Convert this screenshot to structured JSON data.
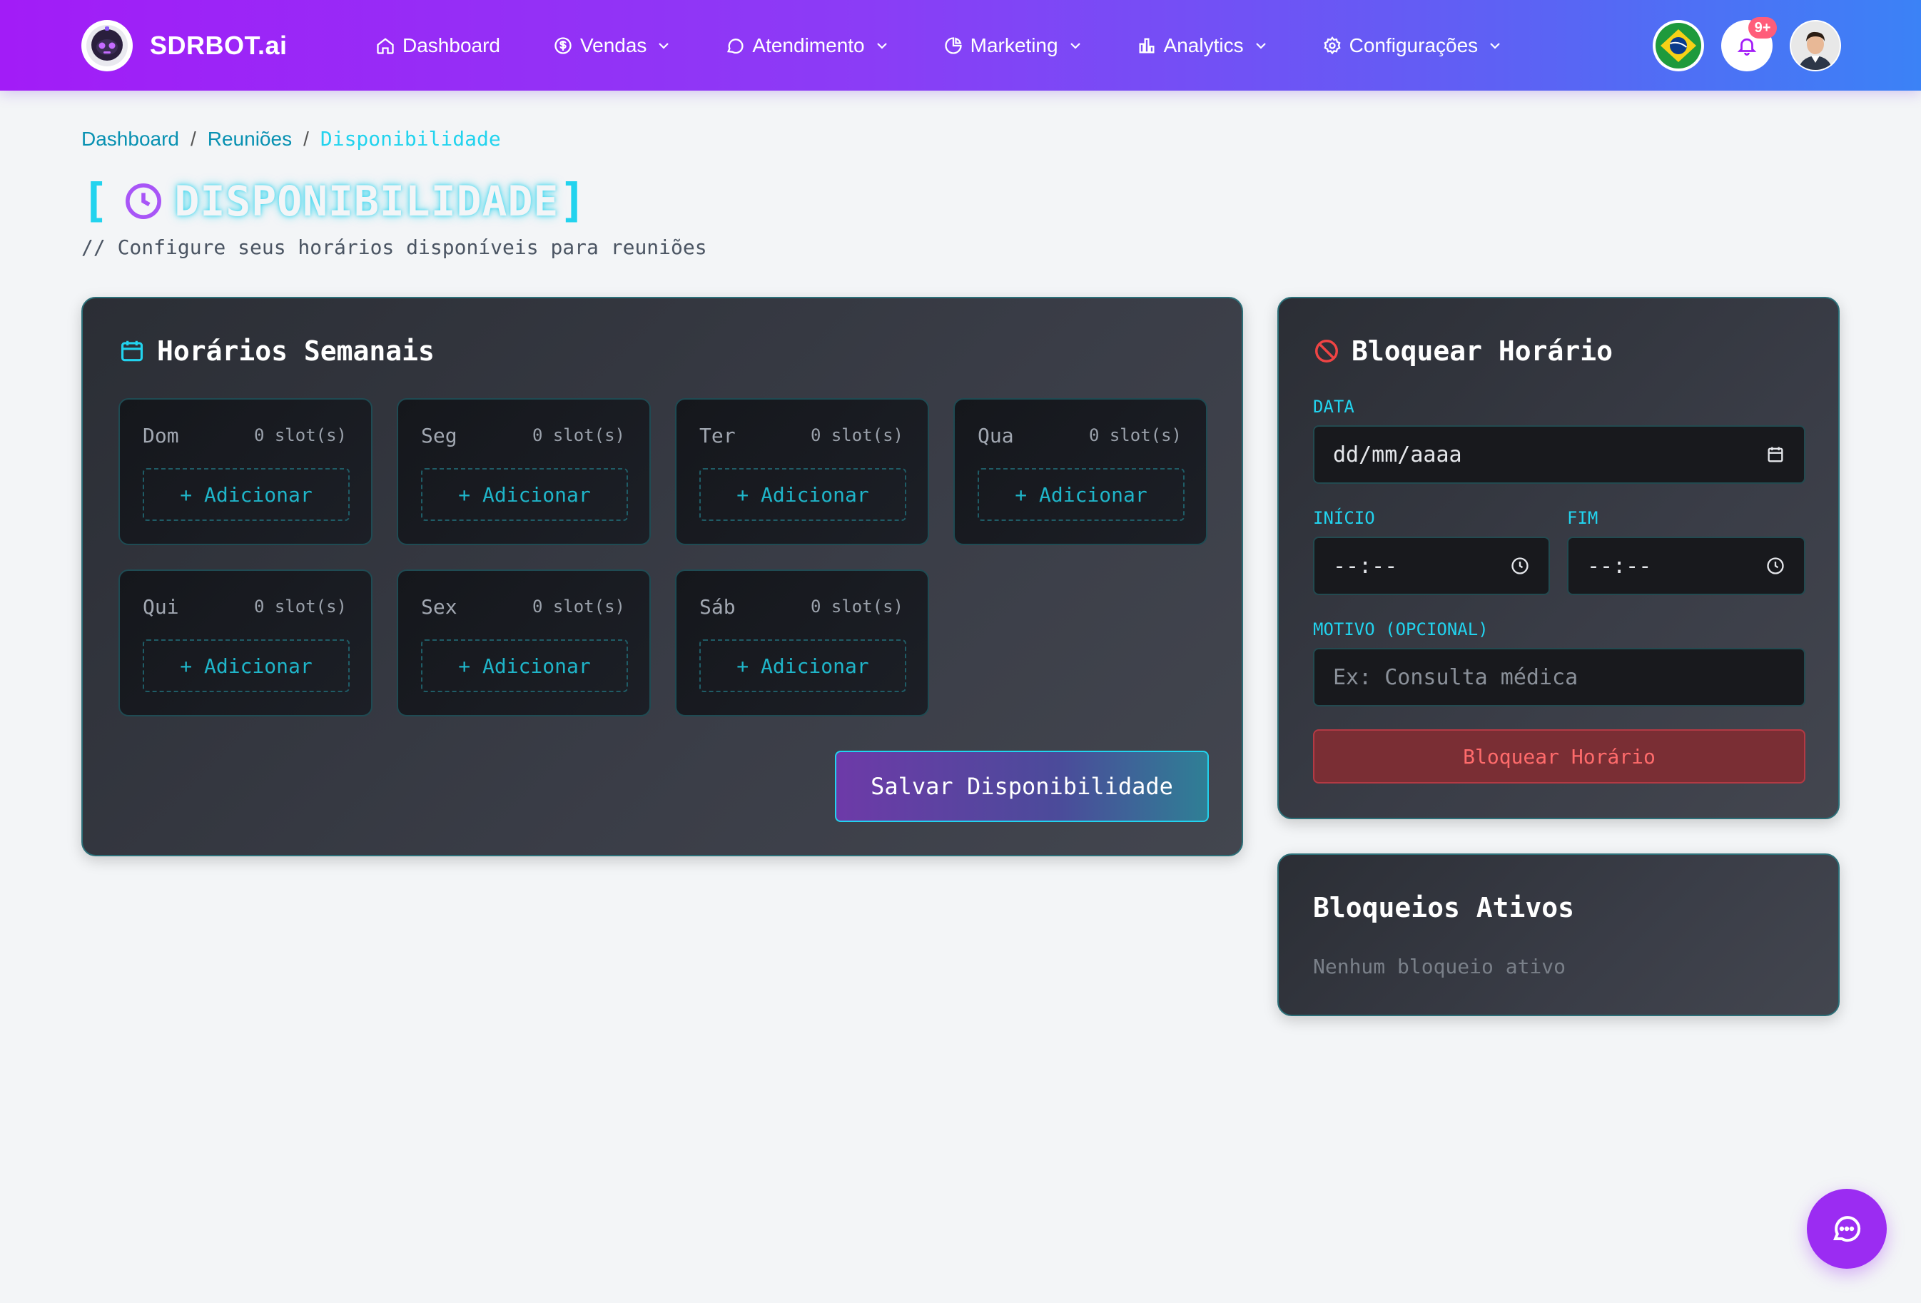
{
  "brand": {
    "name": "SDRBOT.ai"
  },
  "nav": {
    "items": [
      {
        "label": "Dashboard",
        "icon": "home-icon",
        "dropdown": false
      },
      {
        "label": "Vendas",
        "icon": "dollar-icon",
        "dropdown": true
      },
      {
        "label": "Atendimento",
        "icon": "chat-icon",
        "dropdown": true
      },
      {
        "label": "Marketing",
        "icon": "pie-icon",
        "dropdown": true
      },
      {
        "label": "Analytics",
        "icon": "bar-chart-icon",
        "dropdown": true
      },
      {
        "label": "Configurações",
        "icon": "gear-icon",
        "dropdown": true
      }
    ],
    "notifications_badge": "9+"
  },
  "breadcrumb": {
    "items": [
      "Dashboard",
      "Reuniões",
      "Disponibilidade"
    ],
    "separator": "/"
  },
  "header": {
    "bracket_open": "[",
    "bracket_close": "]",
    "title": "DISPONIBILIDADE",
    "subtitle": "// Configure seus horários disponíveis para reuniões"
  },
  "weekly": {
    "title": "Horários Semanais",
    "days": [
      {
        "name": "Dom",
        "slots": "0 slot(s)",
        "add": "+ Adicionar"
      },
      {
        "name": "Seg",
        "slots": "0 slot(s)",
        "add": "+ Adicionar"
      },
      {
        "name": "Ter",
        "slots": "0 slot(s)",
        "add": "+ Adicionar"
      },
      {
        "name": "Qua",
        "slots": "0 slot(s)",
        "add": "+ Adicionar"
      },
      {
        "name": "Qui",
        "slots": "0 slot(s)",
        "add": "+ Adicionar"
      },
      {
        "name": "Sex",
        "slots": "0 slot(s)",
        "add": "+ Adicionar"
      },
      {
        "name": "Sáb",
        "slots": "0 slot(s)",
        "add": "+ Adicionar"
      }
    ],
    "save_label": "Salvar Disponibilidade"
  },
  "block": {
    "title": "Bloquear Horário",
    "date_label": "DATA",
    "date_placeholder": "dd/mm/aaaa",
    "start_label": "INÍCIO",
    "start_placeholder": "--:--",
    "end_label": "FIM",
    "end_placeholder": "--:--",
    "reason_label": "MOTIVO (OPCIONAL)",
    "reason_placeholder": "Ex: Consulta médica",
    "button": "Bloquear Horário"
  },
  "active": {
    "title": "Bloqueios Ativos",
    "empty": "Nenhum bloqueio ativo"
  },
  "colors": {
    "accent": "#22d3ee",
    "brand_purple": "#9b2cf2",
    "danger": "#ff6b6b"
  }
}
